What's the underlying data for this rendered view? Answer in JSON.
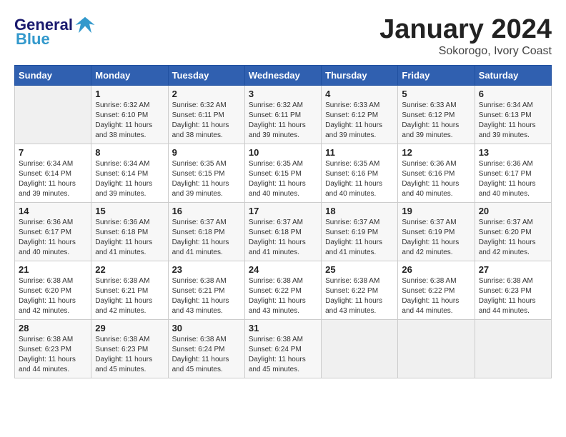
{
  "logo": {
    "general": "General",
    "blue": "Blue"
  },
  "title": {
    "month": "January 2024",
    "location": "Sokorogo, Ivory Coast"
  },
  "headers": [
    "Sunday",
    "Monday",
    "Tuesday",
    "Wednesday",
    "Thursday",
    "Friday",
    "Saturday"
  ],
  "weeks": [
    [
      {
        "day": "",
        "info": ""
      },
      {
        "day": "1",
        "info": "Sunrise: 6:32 AM\nSunset: 6:10 PM\nDaylight: 11 hours\nand 38 minutes."
      },
      {
        "day": "2",
        "info": "Sunrise: 6:32 AM\nSunset: 6:11 PM\nDaylight: 11 hours\nand 38 minutes."
      },
      {
        "day": "3",
        "info": "Sunrise: 6:32 AM\nSunset: 6:11 PM\nDaylight: 11 hours\nand 39 minutes."
      },
      {
        "day": "4",
        "info": "Sunrise: 6:33 AM\nSunset: 6:12 PM\nDaylight: 11 hours\nand 39 minutes."
      },
      {
        "day": "5",
        "info": "Sunrise: 6:33 AM\nSunset: 6:12 PM\nDaylight: 11 hours\nand 39 minutes."
      },
      {
        "day": "6",
        "info": "Sunrise: 6:34 AM\nSunset: 6:13 PM\nDaylight: 11 hours\nand 39 minutes."
      }
    ],
    [
      {
        "day": "7",
        "info": "Sunrise: 6:34 AM\nSunset: 6:14 PM\nDaylight: 11 hours\nand 39 minutes."
      },
      {
        "day": "8",
        "info": "Sunrise: 6:34 AM\nSunset: 6:14 PM\nDaylight: 11 hours\nand 39 minutes."
      },
      {
        "day": "9",
        "info": "Sunrise: 6:35 AM\nSunset: 6:15 PM\nDaylight: 11 hours\nand 39 minutes."
      },
      {
        "day": "10",
        "info": "Sunrise: 6:35 AM\nSunset: 6:15 PM\nDaylight: 11 hours\nand 40 minutes."
      },
      {
        "day": "11",
        "info": "Sunrise: 6:35 AM\nSunset: 6:16 PM\nDaylight: 11 hours\nand 40 minutes."
      },
      {
        "day": "12",
        "info": "Sunrise: 6:36 AM\nSunset: 6:16 PM\nDaylight: 11 hours\nand 40 minutes."
      },
      {
        "day": "13",
        "info": "Sunrise: 6:36 AM\nSunset: 6:17 PM\nDaylight: 11 hours\nand 40 minutes."
      }
    ],
    [
      {
        "day": "14",
        "info": "Sunrise: 6:36 AM\nSunset: 6:17 PM\nDaylight: 11 hours\nand 40 minutes."
      },
      {
        "day": "15",
        "info": "Sunrise: 6:36 AM\nSunset: 6:18 PM\nDaylight: 11 hours\nand 41 minutes."
      },
      {
        "day": "16",
        "info": "Sunrise: 6:37 AM\nSunset: 6:18 PM\nDaylight: 11 hours\nand 41 minutes."
      },
      {
        "day": "17",
        "info": "Sunrise: 6:37 AM\nSunset: 6:18 PM\nDaylight: 11 hours\nand 41 minutes."
      },
      {
        "day": "18",
        "info": "Sunrise: 6:37 AM\nSunset: 6:19 PM\nDaylight: 11 hours\nand 41 minutes."
      },
      {
        "day": "19",
        "info": "Sunrise: 6:37 AM\nSunset: 6:19 PM\nDaylight: 11 hours\nand 42 minutes."
      },
      {
        "day": "20",
        "info": "Sunrise: 6:37 AM\nSunset: 6:20 PM\nDaylight: 11 hours\nand 42 minutes."
      }
    ],
    [
      {
        "day": "21",
        "info": "Sunrise: 6:38 AM\nSunset: 6:20 PM\nDaylight: 11 hours\nand 42 minutes."
      },
      {
        "day": "22",
        "info": "Sunrise: 6:38 AM\nSunset: 6:21 PM\nDaylight: 11 hours\nand 42 minutes."
      },
      {
        "day": "23",
        "info": "Sunrise: 6:38 AM\nSunset: 6:21 PM\nDaylight: 11 hours\nand 43 minutes."
      },
      {
        "day": "24",
        "info": "Sunrise: 6:38 AM\nSunset: 6:22 PM\nDaylight: 11 hours\nand 43 minutes."
      },
      {
        "day": "25",
        "info": "Sunrise: 6:38 AM\nSunset: 6:22 PM\nDaylight: 11 hours\nand 43 minutes."
      },
      {
        "day": "26",
        "info": "Sunrise: 6:38 AM\nSunset: 6:22 PM\nDaylight: 11 hours\nand 44 minutes."
      },
      {
        "day": "27",
        "info": "Sunrise: 6:38 AM\nSunset: 6:23 PM\nDaylight: 11 hours\nand 44 minutes."
      }
    ],
    [
      {
        "day": "28",
        "info": "Sunrise: 6:38 AM\nSunset: 6:23 PM\nDaylight: 11 hours\nand 44 minutes."
      },
      {
        "day": "29",
        "info": "Sunrise: 6:38 AM\nSunset: 6:23 PM\nDaylight: 11 hours\nand 45 minutes."
      },
      {
        "day": "30",
        "info": "Sunrise: 6:38 AM\nSunset: 6:24 PM\nDaylight: 11 hours\nand 45 minutes."
      },
      {
        "day": "31",
        "info": "Sunrise: 6:38 AM\nSunset: 6:24 PM\nDaylight: 11 hours\nand 45 minutes."
      },
      {
        "day": "",
        "info": ""
      },
      {
        "day": "",
        "info": ""
      },
      {
        "day": "",
        "info": ""
      }
    ]
  ]
}
